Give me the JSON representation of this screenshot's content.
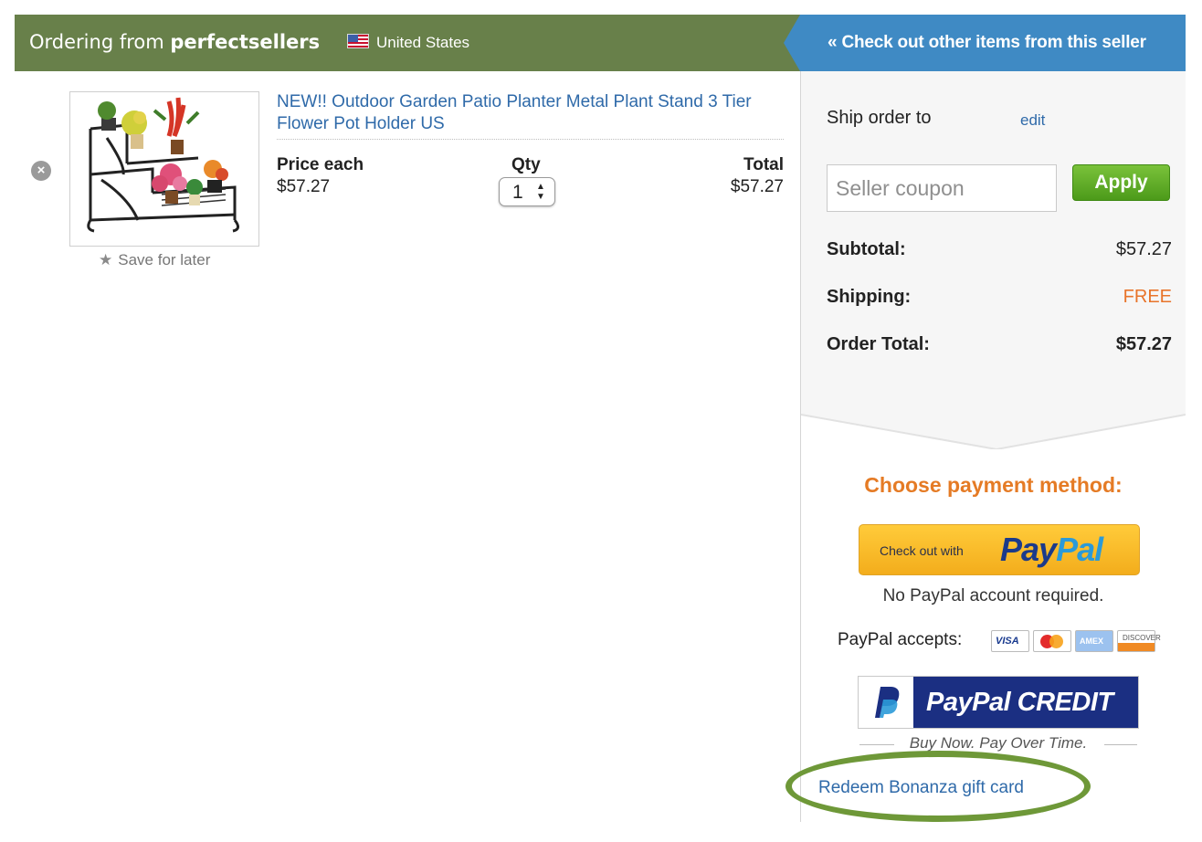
{
  "header": {
    "prefix": "Ordering from",
    "seller": "perfectsellers",
    "country": "United States",
    "other_items_link": "« Check out other items from this seller"
  },
  "cart_item": {
    "title": "NEW!! Outdoor Garden Patio Planter Metal Plant Stand 3 Tier Flower Pot Holder US",
    "save_for_later": "Save for later",
    "price_label": "Price each",
    "price_value": "$57.27",
    "qty_label": "Qty",
    "qty_value": "1",
    "total_label": "Total",
    "total_value": "$57.27"
  },
  "sidebar": {
    "ship_label": "Ship order to",
    "edit_link": "edit",
    "coupon_placeholder": "Seller coupon",
    "apply_button": "Apply",
    "subtotal_label": "Subtotal:",
    "subtotal_value": "$57.27",
    "shipping_label": "Shipping:",
    "shipping_value": "FREE",
    "order_total_label": "Order Total:",
    "order_total_value": "$57.27",
    "payment_heading": "Choose payment method:",
    "paypal_pre": "Check out with",
    "paypal_pay": "Pay",
    "paypal_pal": "Pal",
    "no_account": "No PayPal account required.",
    "accepts_label": "PayPal accepts:",
    "card_visa": "VISA",
    "card_amex": "AMEX",
    "card_discover": "DISCOVER",
    "paypal_credit": "PayPal CREDIT",
    "credit_tagline": "Buy Now. Pay Over Time.",
    "redeem_link": "Redeem Bonanza gift card"
  },
  "colors": {
    "header_green": "#68804a",
    "header_blue": "#3f8ac4",
    "link_blue": "#2f6aa9",
    "accent_orange": "#e57b25",
    "apply_green": "#5aa61f",
    "highlight_ring": "#6e9838"
  },
  "icons": {
    "remove": "close-circle-icon",
    "save": "star-icon",
    "flag": "us-flag-icon",
    "qty_arrows": "up-down-arrows-icon"
  }
}
